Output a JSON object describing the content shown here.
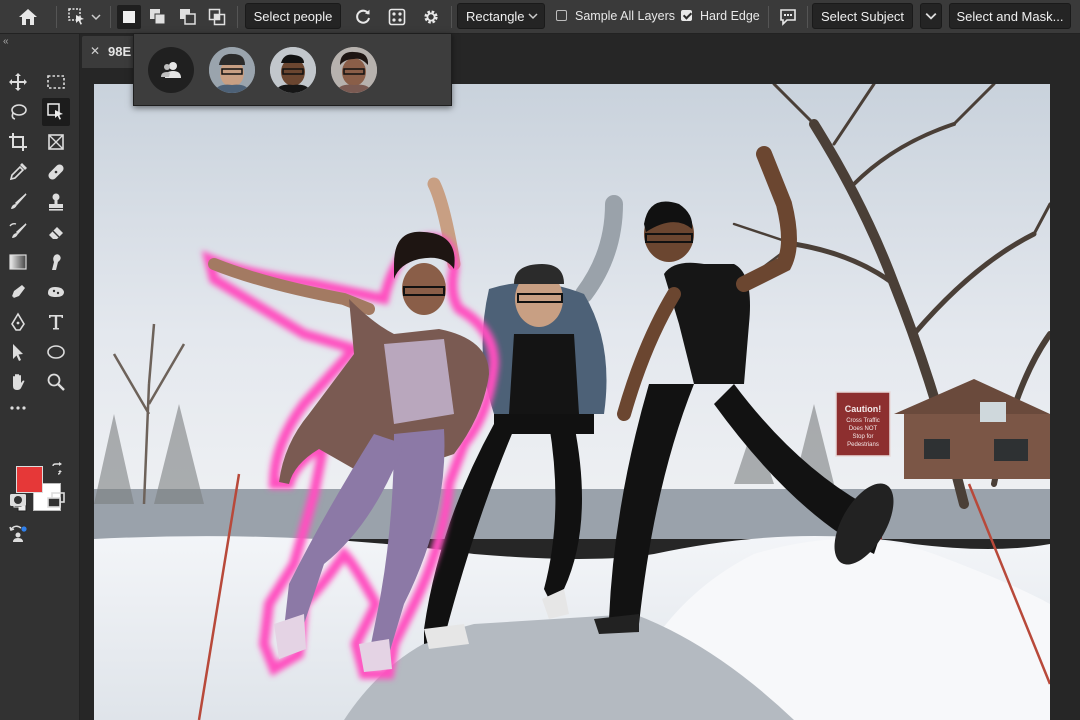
{
  "toolbar": {
    "select_people_label": "Select people",
    "shape_select_value": "Rectangle",
    "sample_all_layers_label": "Sample All Layers",
    "sample_all_layers_checked": false,
    "hard_edge_label": "Hard Edge",
    "hard_edge_checked": true,
    "select_subject_label": "Select Subject",
    "select_and_mask_label": "Select and Mask..."
  },
  "document": {
    "tab_title": "98E"
  },
  "people_popover": {
    "items": [
      "all-people",
      "person-1",
      "person-2",
      "person-3"
    ]
  },
  "colors": {
    "foreground": "#e63838",
    "background": "#ffffff",
    "selection_highlight": "#ff4fc0"
  },
  "canvas": {
    "sign_text": [
      "Caution!",
      "Cross Traffic",
      "Does NOT",
      "Stop for",
      "Pedestrians"
    ]
  },
  "icons": {
    "home": "home-icon",
    "selection_tool": "object-selection-icon",
    "refresh": "refresh-icon",
    "settings": "gear-icon",
    "feedback": "feedback-icon"
  }
}
